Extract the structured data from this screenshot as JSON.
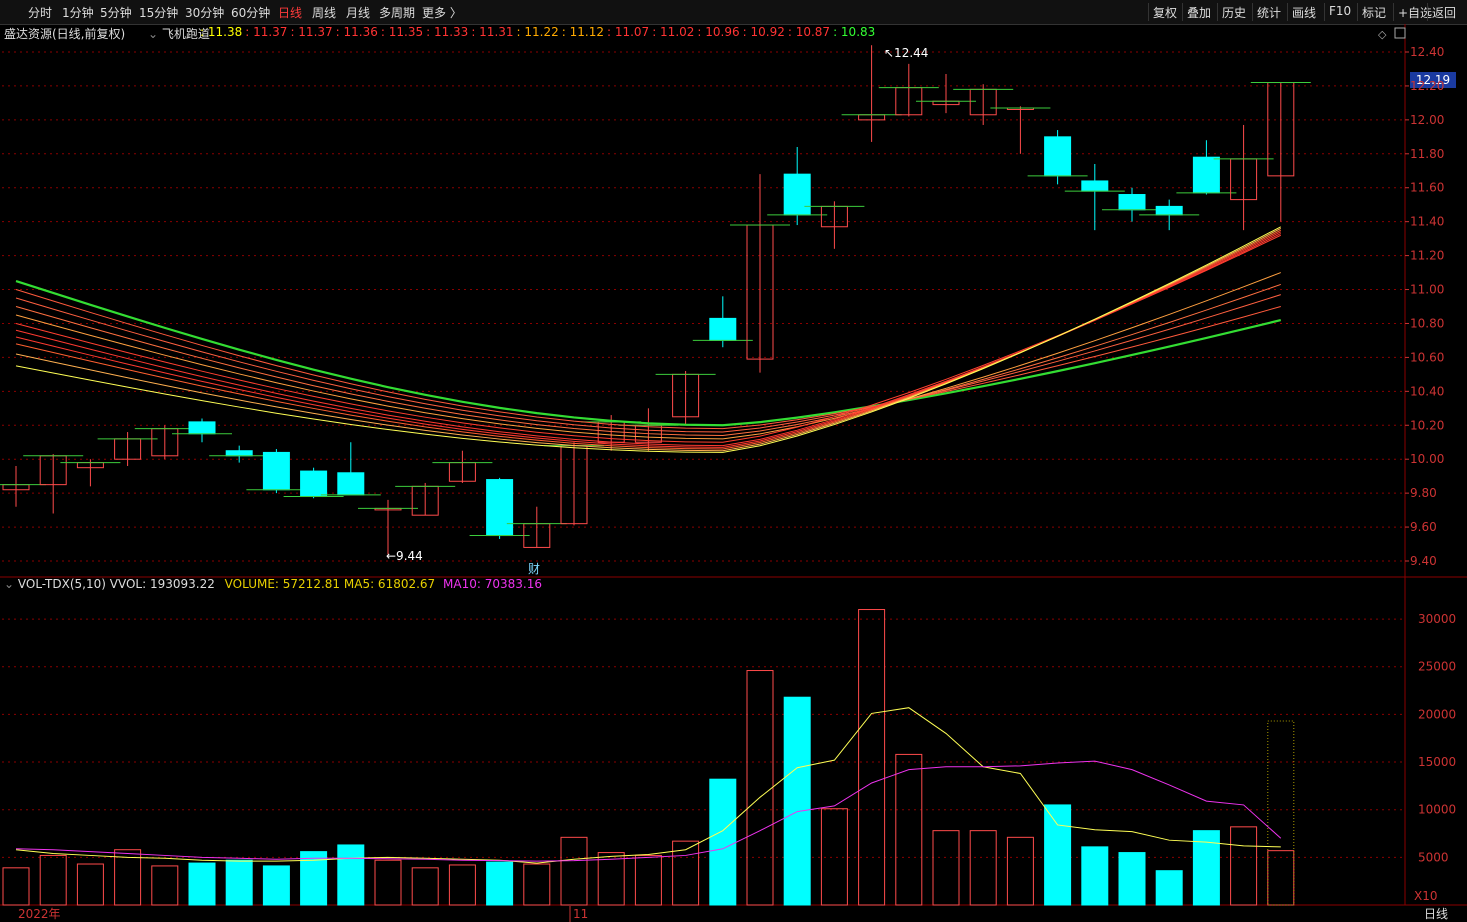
{
  "toolbar": {
    "periods": [
      {
        "label": "分时"
      },
      {
        "label": "1分钟"
      },
      {
        "label": "5分钟"
      },
      {
        "label": "15分钟"
      },
      {
        "label": "30分钟"
      },
      {
        "label": "60分钟"
      },
      {
        "label": "日线"
      },
      {
        "label": "周线"
      },
      {
        "label": "月线"
      },
      {
        "label": "多周期"
      },
      {
        "label": "更多 〉"
      }
    ],
    "active_period": "日线",
    "tools": [
      {
        "label": "复权"
      },
      {
        "label": "叠加"
      },
      {
        "label": "历史"
      },
      {
        "label": "统计"
      },
      {
        "label": "画线"
      },
      {
        "label": "F10"
      },
      {
        "label": "标记"
      },
      {
        "label": "+自选"
      },
      {
        "label": "返回"
      }
    ]
  },
  "info": {
    "stock_name": "盛达资源(日线,前复权)",
    "indicator_name": "飞机跑道",
    "ma_values": [
      "11.38",
      "11.37",
      "11.37",
      "11.36",
      "11.35",
      "11.33",
      "11.31",
      "11.22",
      "11.12",
      "11.07",
      "11.02",
      "10.96",
      "10.92",
      "10.87",
      "10.83"
    ]
  },
  "volume_info": {
    "name": "VOL-TDX(5,10)",
    "vvol": "VVOL: 193093.22",
    "volume": "VOLUME: 57212.81",
    "ma5": "MA5: 61802.67",
    "ma10": "MA10: 70383.16"
  },
  "price_axis": {
    "ticks": [
      "12.40",
      "12.20",
      "12.00",
      "11.80",
      "11.60",
      "11.40",
      "11.20",
      "11.00",
      "10.80",
      "10.60",
      "10.40",
      "10.20",
      "10.00",
      "9.80",
      "9.60",
      "9.40"
    ],
    "current_price": "12.19"
  },
  "volume_axis": {
    "ticks": [
      "30000",
      "25000",
      "20000",
      "15000",
      "10000",
      "5000"
    ],
    "unit": "X10"
  },
  "annotations": {
    "high": "12.44",
    "low": "9.44",
    "fin_marker": "财"
  },
  "bottom": {
    "year_label": "2022年",
    "month_label": "11",
    "period_tab": "日线"
  },
  "colors": {
    "up": "#ff4b4b",
    "down": "#00ffff",
    "ma_green": "#33dd33",
    "ma_yellow": "#ffff55",
    "ma_magenta": "#ee33ee",
    "grid": "#8b0000"
  },
  "chart_data": {
    "type": "candlestick",
    "price_range": [
      9.35,
      12.5
    ],
    "candles": [
      {
        "o": 9.82,
        "h": 9.96,
        "l": 9.72,
        "c": 9.85
      },
      {
        "o": 9.85,
        "h": 10.03,
        "l": 9.68,
        "c": 10.02
      },
      {
        "o": 9.95,
        "h": 10.0,
        "l": 9.84,
        "c": 9.98
      },
      {
        "o": 10.0,
        "h": 10.16,
        "l": 9.96,
        "c": 10.12
      },
      {
        "o": 10.02,
        "h": 10.2,
        "l": 10.0,
        "c": 10.18
      },
      {
        "o": 10.22,
        "h": 10.24,
        "l": 10.1,
        "c": 10.15
      },
      {
        "o": 10.05,
        "h": 10.08,
        "l": 9.98,
        "c": 10.02
      },
      {
        "o": 10.04,
        "h": 10.06,
        "l": 9.8,
        "c": 9.82
      },
      {
        "o": 9.93,
        "h": 9.95,
        "l": 9.77,
        "c": 9.78
      },
      {
        "o": 9.92,
        "h": 10.1,
        "l": 9.79,
        "c": 9.79
      },
      {
        "o": 9.71,
        "h": 9.76,
        "l": 9.44,
        "c": 9.71
      },
      {
        "o": 9.67,
        "h": 9.86,
        "l": 9.67,
        "c": 9.84
      },
      {
        "o": 9.87,
        "h": 10.05,
        "l": 9.86,
        "c": 9.98
      },
      {
        "o": 9.88,
        "h": 9.89,
        "l": 9.53,
        "c": 9.55
      },
      {
        "o": 9.48,
        "h": 9.72,
        "l": 9.48,
        "c": 9.62
      },
      {
        "o": 9.62,
        "h": 10.1,
        "l": 9.61,
        "c": 10.08
      },
      {
        "o": 10.1,
        "h": 10.26,
        "l": 10.05,
        "c": 10.22
      },
      {
        "o": 10.1,
        "h": 10.3,
        "l": 10.05,
        "c": 10.2
      },
      {
        "o": 10.25,
        "h": 10.52,
        "l": 10.2,
        "c": 10.5
      },
      {
        "o": 10.83,
        "h": 10.96,
        "l": 10.66,
        "c": 10.7
      },
      {
        "o": 10.59,
        "h": 11.68,
        "l": 10.51,
        "c": 11.38
      },
      {
        "o": 11.68,
        "h": 11.84,
        "l": 11.38,
        "c": 11.44
      },
      {
        "o": 11.37,
        "h": 11.52,
        "l": 11.24,
        "c": 11.49
      },
      {
        "o": 12.0,
        "h": 12.44,
        "l": 11.87,
        "c": 12.03
      },
      {
        "o": 12.03,
        "h": 12.33,
        "l": 12.02,
        "c": 12.19
      },
      {
        "o": 12.09,
        "h": 12.27,
        "l": 12.04,
        "c": 12.11
      },
      {
        "o": 12.03,
        "h": 12.21,
        "l": 11.97,
        "c": 12.18
      },
      {
        "o": 12.07,
        "h": 12.08,
        "l": 11.8,
        "c": 12.07
      },
      {
        "o": 11.9,
        "h": 11.94,
        "l": 11.62,
        "c": 11.67
      },
      {
        "o": 11.64,
        "h": 11.74,
        "l": 11.35,
        "c": 11.58
      },
      {
        "o": 11.56,
        "h": 11.6,
        "l": 11.4,
        "c": 11.47
      },
      {
        "o": 11.49,
        "h": 11.53,
        "l": 11.35,
        "c": 11.44
      },
      {
        "o": 11.78,
        "h": 11.88,
        "l": 11.56,
        "c": 11.57
      },
      {
        "o": 11.53,
        "h": 11.97,
        "l": 11.35,
        "c": 11.77
      },
      {
        "o": 11.67,
        "h": 12.22,
        "l": 11.4,
        "c": 12.22
      }
    ],
    "volumes": [
      3900,
      5200,
      4300,
      5800,
      4100,
      4400,
      4700,
      4100,
      5600,
      6300,
      4700,
      3900,
      4200,
      4500,
      4300,
      7100,
      5500,
      5200,
      6700,
      13200,
      24600,
      21800,
      10100,
      31000,
      15800,
      7800,
      7800,
      7100,
      10500,
      6100,
      5500,
      3600,
      7800,
      8200,
      5700
    ],
    "vol_ma5": [
      5800,
      5400,
      5200,
      5000,
      4900,
      4700,
      4600,
      4600,
      4700,
      4900,
      5000,
      4900,
      4800,
      4700,
      4400,
      4800,
      5100,
      5300,
      5800,
      7800,
      11300,
      14400,
      15200,
      20100,
      20700,
      18000,
      14500,
      13800,
      8400,
      7900,
      7700,
      6800,
      6600,
      6200,
      6100
    ],
    "vol_ma10": [
      5900,
      5800,
      5600,
      5400,
      5200,
      5000,
      4900,
      4800,
      4900,
      4900,
      4850,
      4800,
      4700,
      4650,
      4600,
      4650,
      4800,
      5000,
      5200,
      5900,
      7800,
      9800,
      10400,
      12800,
      14200,
      14500,
      14500,
      14600,
      14900,
      15100,
      14200,
      12600,
      10900,
      10500,
      7000
    ]
  }
}
